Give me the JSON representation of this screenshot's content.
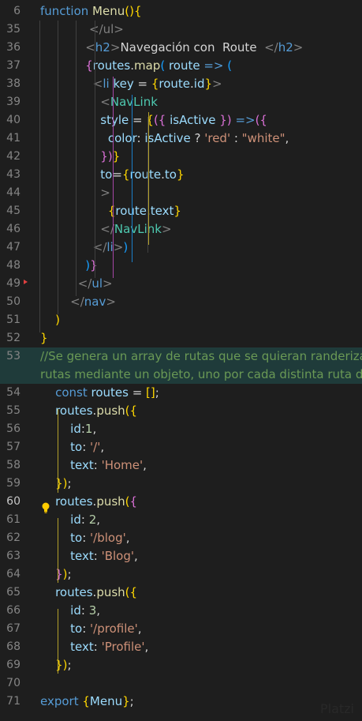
{
  "editor": {
    "lines": [
      {
        "num": "6",
        "segments": [
          {
            "t": "function ",
            "c": "k"
          },
          {
            "t": "Menu",
            "c": "f"
          },
          {
            "t": "(){",
            "c": "br1"
          }
        ]
      },
      {
        "num": "35",
        "segments": [
          {
            "t": "             ",
            "c": ""
          },
          {
            "t": "</ul>",
            "c": "ang"
          }
        ]
      },
      {
        "num": "36",
        "segments": [
          {
            "t": "            ",
            "c": ""
          },
          {
            "t": "<",
            "c": "ang"
          },
          {
            "t": "h2",
            "c": "k"
          },
          {
            "t": ">",
            "c": "ang"
          },
          {
            "t": "Navegación con  Route  ",
            "c": ""
          },
          {
            "t": "</",
            "c": "ang"
          },
          {
            "t": "h2",
            "c": "k"
          },
          {
            "t": ">",
            "c": "ang"
          }
        ]
      },
      {
        "num": "37",
        "segments": [
          {
            "t": "            ",
            "c": ""
          },
          {
            "t": "{",
            "c": "br2"
          },
          {
            "t": "routes",
            "c": "v"
          },
          {
            "t": ".",
            "c": ""
          },
          {
            "t": "map",
            "c": "f"
          },
          {
            "t": "( ",
            "c": "br3"
          },
          {
            "t": "route",
            "c": "v"
          },
          {
            "t": " => ",
            "c": "k"
          },
          {
            "t": "(",
            "c": "br3"
          }
        ]
      },
      {
        "num": "38",
        "segments": [
          {
            "t": "              ",
            "c": ""
          },
          {
            "t": "<",
            "c": "ang"
          },
          {
            "t": "li",
            "c": "k"
          },
          {
            "t": " key",
            "c": "v"
          },
          {
            "t": " = ",
            "c": ""
          },
          {
            "t": "{",
            "c": "br1"
          },
          {
            "t": "route",
            "c": "v"
          },
          {
            "t": ".",
            "c": ""
          },
          {
            "t": "id",
            "c": "v"
          },
          {
            "t": "}",
            "c": "br1"
          },
          {
            "t": ">",
            "c": "ang"
          }
        ]
      },
      {
        "num": "39",
        "segments": [
          {
            "t": "                ",
            "c": ""
          },
          {
            "t": "<",
            "c": "ang"
          },
          {
            "t": "NavLink",
            "c": "tag"
          }
        ]
      },
      {
        "num": "40",
        "segments": [
          {
            "t": "                ",
            "c": ""
          },
          {
            "t": "style",
            "c": "v"
          },
          {
            "t": " = ",
            "c": ""
          },
          {
            "t": "{",
            "c": "br1"
          },
          {
            "t": "({ ",
            "c": "br2"
          },
          {
            "t": "isActive",
            "c": "v"
          },
          {
            "t": " }) ",
            "c": "br2"
          },
          {
            "t": "=>",
            "c": "k"
          },
          {
            "t": "({",
            "c": "br2"
          }
        ]
      },
      {
        "num": "41",
        "segments": [
          {
            "t": "                  ",
            "c": ""
          },
          {
            "t": "color",
            "c": "v"
          },
          {
            "t": ": ",
            "c": ""
          },
          {
            "t": "isActive",
            "c": "v"
          },
          {
            "t": " ? ",
            "c": ""
          },
          {
            "t": "'red'",
            "c": "s"
          },
          {
            "t": " : ",
            "c": ""
          },
          {
            "t": "\"white\"",
            "c": "s"
          },
          {
            "t": ",",
            "c": ""
          }
        ]
      },
      {
        "num": "42",
        "segments": [
          {
            "t": "                ",
            "c": ""
          },
          {
            "t": "})",
            "c": "br2"
          },
          {
            "t": "}",
            "c": "br1"
          }
        ]
      },
      {
        "num": "43",
        "segments": [
          {
            "t": "                ",
            "c": ""
          },
          {
            "t": "to",
            "c": "v"
          },
          {
            "t": "=",
            "c": ""
          },
          {
            "t": "{",
            "c": "br1"
          },
          {
            "t": "route",
            "c": "v"
          },
          {
            "t": ".",
            "c": ""
          },
          {
            "t": "to",
            "c": "v"
          },
          {
            "t": "}",
            "c": "br1"
          }
        ]
      },
      {
        "num": "44",
        "segments": [
          {
            "t": "                ",
            "c": ""
          },
          {
            "t": ">",
            "c": "ang"
          }
        ]
      },
      {
        "num": "45",
        "segments": [
          {
            "t": "                  ",
            "c": ""
          },
          {
            "t": "{",
            "c": "br1"
          },
          {
            "t": "route",
            "c": "v"
          },
          {
            "t": ".",
            "c": ""
          },
          {
            "t": "text",
            "c": "v"
          },
          {
            "t": "}",
            "c": "br1"
          }
        ]
      },
      {
        "num": "46",
        "segments": [
          {
            "t": "                ",
            "c": ""
          },
          {
            "t": "</",
            "c": "ang"
          },
          {
            "t": "NavLink",
            "c": "tag"
          },
          {
            "t": ">",
            "c": "ang"
          }
        ]
      },
      {
        "num": "47",
        "segments": [
          {
            "t": "              ",
            "c": ""
          },
          {
            "t": "</",
            "c": "ang"
          },
          {
            "t": "li",
            "c": "k"
          },
          {
            "t": ">",
            "c": "ang"
          },
          {
            "t": ")",
            "c": "br3"
          }
        ]
      },
      {
        "num": "48",
        "segments": [
          {
            "t": "            ",
            "c": ""
          },
          {
            "t": ")",
            "c": "br3"
          },
          {
            "t": "}",
            "c": "br2"
          }
        ]
      },
      {
        "num": "49",
        "segments": [
          {
            "t": "          ",
            "c": ""
          },
          {
            "t": "</",
            "c": "ang"
          },
          {
            "t": "ul",
            "c": "k"
          },
          {
            "t": ">",
            "c": "ang"
          }
        ]
      },
      {
        "num": "50",
        "segments": [
          {
            "t": "        ",
            "c": ""
          },
          {
            "t": "</",
            "c": "ang"
          },
          {
            "t": "nav",
            "c": "k"
          },
          {
            "t": ">",
            "c": "ang"
          }
        ]
      },
      {
        "num": "51",
        "segments": [
          {
            "t": "    ",
            "c": ""
          },
          {
            "t": ")",
            "c": "br1"
          }
        ]
      },
      {
        "num": "52",
        "segments": [
          {
            "t": "}",
            "c": "br1"
          }
        ]
      },
      {
        "num": "53",
        "hl": true,
        "segments": [
          {
            "t": "//Se genera un array de rutas que se quieran randeriza",
            "c": "c"
          }
        ]
      },
      {
        "num": "",
        "hl": true,
        "segments": [
          {
            "t": "rutas mediante un objeto, uno por cada distinta ruta dor",
            "c": "c"
          }
        ]
      },
      {
        "num": "54",
        "segments": [
          {
            "t": "    ",
            "c": ""
          },
          {
            "t": "const",
            "c": "k"
          },
          {
            "t": " routes",
            "c": "v"
          },
          {
            "t": " = ",
            "c": ""
          },
          {
            "t": "[]",
            "c": "br1"
          },
          {
            "t": ";",
            "c": ""
          }
        ]
      },
      {
        "num": "55",
        "segments": [
          {
            "t": "    ",
            "c": ""
          },
          {
            "t": "routes",
            "c": "v"
          },
          {
            "t": ".",
            "c": ""
          },
          {
            "t": "push",
            "c": "f"
          },
          {
            "t": "({",
            "c": "br1"
          }
        ]
      },
      {
        "num": "56",
        "segments": [
          {
            "t": "        ",
            "c": ""
          },
          {
            "t": "id",
            "c": "v"
          },
          {
            "t": ":",
            "c": ""
          },
          {
            "t": "1",
            "c": "n"
          },
          {
            "t": ",",
            "c": ""
          }
        ]
      },
      {
        "num": "57",
        "segments": [
          {
            "t": "        ",
            "c": ""
          },
          {
            "t": "to",
            "c": "v"
          },
          {
            "t": ": ",
            "c": ""
          },
          {
            "t": "'/'",
            "c": "s"
          },
          {
            "t": ",",
            "c": ""
          }
        ]
      },
      {
        "num": "58",
        "segments": [
          {
            "t": "        ",
            "c": ""
          },
          {
            "t": "text",
            "c": "v"
          },
          {
            "t": ": ",
            "c": ""
          },
          {
            "t": "'Home'",
            "c": "s"
          },
          {
            "t": ",",
            "c": ""
          }
        ]
      },
      {
        "num": "59",
        "segments": [
          {
            "t": "    ",
            "c": ""
          },
          {
            "t": "})",
            "c": "br1"
          },
          {
            "t": ";",
            "c": ""
          }
        ]
      },
      {
        "num": "60",
        "active": true,
        "segments": [
          {
            "t": "    ",
            "c": ""
          },
          {
            "t": "routes",
            "c": "v"
          },
          {
            "t": ".",
            "c": ""
          },
          {
            "t": "push",
            "c": "f"
          },
          {
            "t": "(",
            "c": "br1"
          },
          {
            "t": "{",
            "c": "br2"
          }
        ]
      },
      {
        "num": "61",
        "segments": [
          {
            "t": "        ",
            "c": ""
          },
          {
            "t": "id",
            "c": "v"
          },
          {
            "t": ": ",
            "c": ""
          },
          {
            "t": "2",
            "c": "n"
          },
          {
            "t": ",",
            "c": ""
          }
        ]
      },
      {
        "num": "62",
        "segments": [
          {
            "t": "        ",
            "c": ""
          },
          {
            "t": "to",
            "c": "v"
          },
          {
            "t": ": ",
            "c": ""
          },
          {
            "t": "'/blog'",
            "c": "s"
          },
          {
            "t": ",",
            "c": ""
          }
        ]
      },
      {
        "num": "63",
        "segments": [
          {
            "t": "        ",
            "c": ""
          },
          {
            "t": "text",
            "c": "v"
          },
          {
            "t": ": ",
            "c": ""
          },
          {
            "t": "'Blog'",
            "c": "s"
          },
          {
            "t": ",",
            "c": ""
          }
        ]
      },
      {
        "num": "64",
        "segments": [
          {
            "t": "    ",
            "c": ""
          },
          {
            "t": "}",
            "c": "br2"
          },
          {
            "t": ")",
            "c": "br1"
          },
          {
            "t": ";",
            "c": ""
          }
        ]
      },
      {
        "num": "65",
        "segments": [
          {
            "t": "    ",
            "c": ""
          },
          {
            "t": "routes",
            "c": "v"
          },
          {
            "t": ".",
            "c": ""
          },
          {
            "t": "push",
            "c": "f"
          },
          {
            "t": "({",
            "c": "br1"
          }
        ]
      },
      {
        "num": "66",
        "segments": [
          {
            "t": "        ",
            "c": ""
          },
          {
            "t": "id",
            "c": "v"
          },
          {
            "t": ": ",
            "c": ""
          },
          {
            "t": "3",
            "c": "n"
          },
          {
            "t": ",",
            "c": ""
          }
        ]
      },
      {
        "num": "67",
        "segments": [
          {
            "t": "        ",
            "c": ""
          },
          {
            "t": "to",
            "c": "v"
          },
          {
            "t": ": ",
            "c": ""
          },
          {
            "t": "'/profile'",
            "c": "s"
          },
          {
            "t": ",",
            "c": ""
          }
        ]
      },
      {
        "num": "68",
        "segments": [
          {
            "t": "        ",
            "c": ""
          },
          {
            "t": "text",
            "c": "v"
          },
          {
            "t": ": ",
            "c": ""
          },
          {
            "t": "'Profile'",
            "c": "s"
          },
          {
            "t": ",",
            "c": ""
          }
        ]
      },
      {
        "num": "69",
        "segments": [
          {
            "t": "    ",
            "c": ""
          },
          {
            "t": "})",
            "c": "br1"
          },
          {
            "t": ";",
            "c": ""
          }
        ]
      },
      {
        "num": "70",
        "segments": []
      },
      {
        "num": "71",
        "segments": [
          {
            "t": "export",
            "c": "k"
          },
          {
            "t": " ",
            "c": ""
          },
          {
            "t": "{",
            "c": "br1"
          },
          {
            "t": "Menu",
            "c": "v"
          },
          {
            "t": "}",
            "c": "br1"
          },
          {
            "t": ";",
            "c": ""
          }
        ]
      }
    ],
    "watermark": "Platzi",
    "colors": {
      "background": "#1e1e1e",
      "keyword": "#569cd6",
      "string": "#ce9178",
      "comment": "#6a9955"
    }
  }
}
